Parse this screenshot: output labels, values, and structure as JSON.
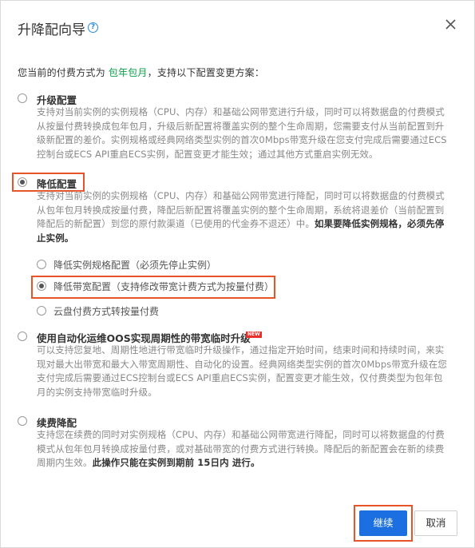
{
  "dialog": {
    "title": "升降配向导",
    "help_icon": "question-circle-icon",
    "close_icon": "close-icon"
  },
  "intro": {
    "prefix": "您当前的付费方式为",
    "billing": "包年包月",
    "suffix": "，支持以下配置变更方案："
  },
  "options": {
    "upgrade": {
      "title": "升级配置",
      "desc": "支持对当前实例的实例规格（CPU、内存）和基础公网带宽进行升级，同时可以将数据盘的付费模式从按量付费转换成包年包月，升级后新配置将覆盖实例的整个生命周期，您需要支付从当前配置到升级新配置的差价。实例规格或经典网络类型实例的首次0Mbps带宽升级在您支付完成后需要通过ECS控制台或ECS API重启ECS实例，配置变更才能生效；通过其他方式重启实例无效。"
    },
    "downgrade": {
      "title": "降低配置",
      "desc": "支持对当前实例的实例规格（CPU、内存）和基础公网带宽进行降配，同时可以将数据盘的付费模式从包年包月转换成按量付费，降配后新配置将覆盖实例的整个生命周期，系统将退差价（当前配置到降配后的新配置）到您的原付款渠道（已使用的代金券不退还）中。",
      "desc_bold": "如果要降低实例规格，必须先停止实例。",
      "sub": [
        "降低实例规格配置（必须先停止实例）",
        "降低带宽配置（支持修改带宽计费方式为按量付费）",
        "云盘付费方式转按量付费"
      ]
    },
    "oos": {
      "title": "使用自动化运维OOS实现周期性的带宽临时升级",
      "badge": "NEW",
      "desc": "可以支持您复地、周期性地进行带宽临时升级操作，通过指定开始时间，结束时间和持续时间，来实现对最大出带宽和最大入带宽周期性、自动化的设置。经典网络类型实例的首次0Mbps带宽升级在您支付完成后需要通过ECS控制台或ECS API重启ECS实例，配置变更才能生效，仅付费类型为包年包月的实例支持带宽临时升级。"
    },
    "renew": {
      "title": "续费降配",
      "desc": "支持您在续费的同时对实例规格（CPU、内存）和基础公网带宽进行降配，同时可以将数据盘的付费模式从包年包月转换成按量付费，或对基础带宽的付费方式进行转换。降配后的新配置会在新的续费周期内生效。",
      "desc_bold": "此操作只能在实例到期前 15日内 进行。"
    }
  },
  "footer": {
    "continue": "继续",
    "cancel": "取消"
  },
  "colors": {
    "accent_green": "#0c9e4a",
    "primary_blue": "#1c6fe0",
    "highlight_red": "#e8542a"
  }
}
